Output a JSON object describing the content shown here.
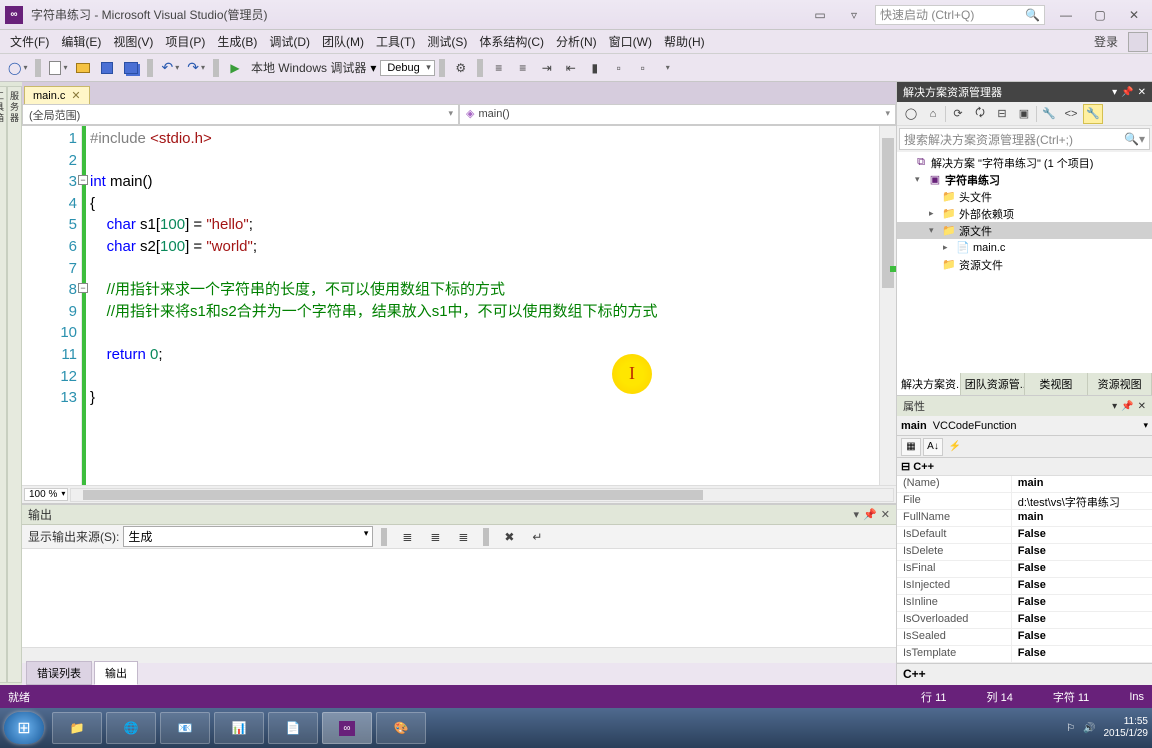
{
  "titlebar": {
    "title": "字符串练习 - Microsoft Visual Studio(管理员)",
    "quick_launch_placeholder": "快速启动 (Ctrl+Q)"
  },
  "menubar": {
    "items": [
      "文件(F)",
      "编辑(E)",
      "视图(V)",
      "项目(P)",
      "生成(B)",
      "调试(D)",
      "团队(M)",
      "工具(T)",
      "测试(S)",
      "体系结构(C)",
      "分析(N)",
      "窗口(W)",
      "帮助(H)"
    ],
    "login": "登录"
  },
  "toolbar": {
    "debug_label": "本地 Windows 调试器",
    "config": "Debug"
  },
  "doc_tab": {
    "name": "main.c"
  },
  "nav": {
    "scope": "(全局范围)",
    "member": "main()"
  },
  "code": {
    "lines": [
      {
        "n": 1,
        "html": "<span class='inc'>#include</span> <span class='str'>&lt;stdio.h&gt;</span>"
      },
      {
        "n": 2,
        "html": ""
      },
      {
        "n": 3,
        "html": "<span class='kw'>int</span> main()",
        "fold": true
      },
      {
        "n": 4,
        "html": "{"
      },
      {
        "n": 5,
        "html": "    <span class='kw'>char</span> s1[<span class='num'>100</span>] = <span class='str'>\"hello\"</span>;"
      },
      {
        "n": 6,
        "html": "    <span class='kw'>char</span> s2[<span class='num'>100</span>] = <span class='str'>\"world\"</span>;"
      },
      {
        "n": 7,
        "html": ""
      },
      {
        "n": 8,
        "html": "    <span class='cmt'>//用指针来求一个字符串的长度，不可以使用数组下标的方式</span>",
        "fold": true
      },
      {
        "n": 9,
        "html": "    <span class='cmt'>//用指针来将s1和s2合并为一个字符串，结果放入s1中，不可以使用数组下标的方式</span>"
      },
      {
        "n": 10,
        "html": ""
      },
      {
        "n": 11,
        "html": "    <span class='kw'>return</span> <span class='num'>0</span>;"
      },
      {
        "n": 12,
        "html": ""
      },
      {
        "n": 13,
        "html": "}"
      }
    ]
  },
  "zoom": "100 %",
  "output": {
    "title": "输出",
    "source_label": "显示输出来源(S):",
    "source_value": "生成",
    "bottom_tabs": [
      "错误列表",
      "输出"
    ],
    "active_tab": 1
  },
  "solution_explorer": {
    "title": "解决方案资源管理器",
    "search_placeholder": "搜索解决方案资源管理器(Ctrl+;)",
    "tree": [
      {
        "level": 0,
        "exp": "",
        "icon": "sol",
        "label": "解决方案 \"字符串练习\" (1 个项目)"
      },
      {
        "level": 1,
        "exp": "▾",
        "icon": "proj",
        "label": "字符串练习",
        "bold": true
      },
      {
        "level": 2,
        "exp": "",
        "icon": "folder",
        "label": "头文件"
      },
      {
        "level": 2,
        "exp": "▸",
        "icon": "folder",
        "label": "外部依赖项"
      },
      {
        "level": 2,
        "exp": "▾",
        "icon": "folder",
        "label": "源文件",
        "selected": true
      },
      {
        "level": 3,
        "exp": "▸",
        "icon": "file",
        "label": "main.c"
      },
      {
        "level": 2,
        "exp": "",
        "icon": "folder",
        "label": "资源文件"
      }
    ],
    "bottom_tabs": [
      "解决方案资...",
      "团队资源管...",
      "类视图",
      "资源视图"
    ]
  },
  "properties": {
    "title": "属性",
    "object_name": "main",
    "object_type": "VCCodeFunction",
    "category": "C++",
    "rows": [
      {
        "name": "(Name)",
        "val": "main",
        "bold": true
      },
      {
        "name": "File",
        "val": "d:\\test\\vs\\字符串练习"
      },
      {
        "name": "FullName",
        "val": "main",
        "bold": true
      },
      {
        "name": "IsDefault",
        "val": "False",
        "bold": true
      },
      {
        "name": "IsDelete",
        "val": "False",
        "bold": true
      },
      {
        "name": "IsFinal",
        "val": "False",
        "bold": true
      },
      {
        "name": "IsInjected",
        "val": "False",
        "bold": true
      },
      {
        "name": "IsInline",
        "val": "False",
        "bold": true
      },
      {
        "name": "IsOverloaded",
        "val": "False",
        "bold": true
      },
      {
        "name": "IsSealed",
        "val": "False",
        "bold": true
      },
      {
        "name": "IsTemplate",
        "val": "False",
        "bold": true
      }
    ],
    "desc": "C++"
  },
  "statusbar": {
    "ready": "就绪",
    "line": "行 11",
    "col": "列 14",
    "char": "字符 11",
    "ins": "Ins"
  },
  "taskbar": {
    "time": "11:55",
    "date": "2015/1/29"
  }
}
